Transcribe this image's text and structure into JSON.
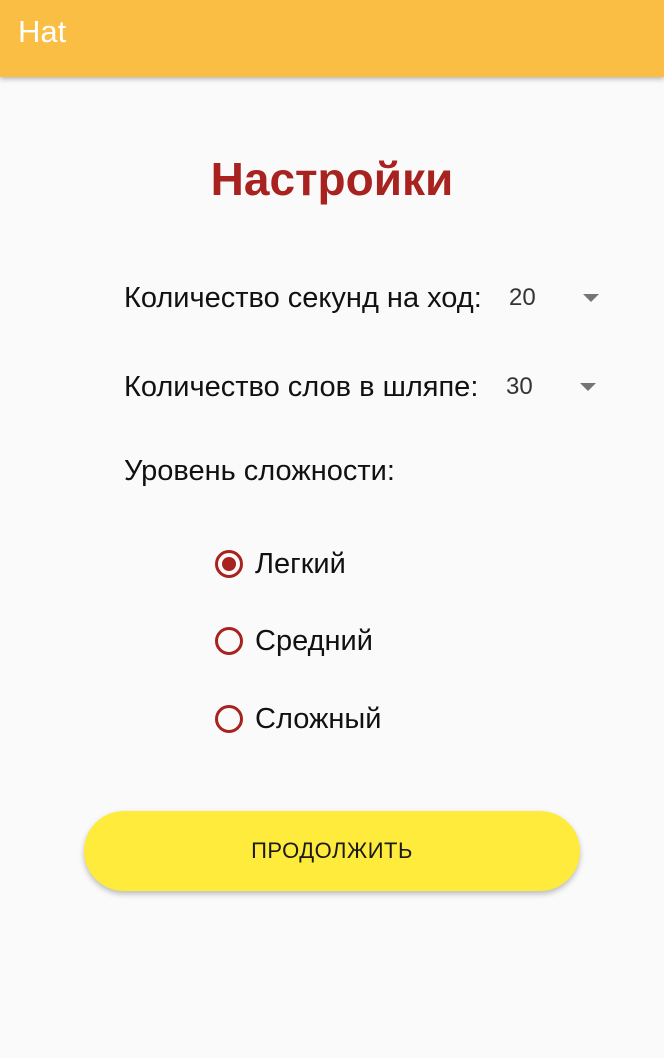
{
  "app_bar": {
    "title": "Hat",
    "color": "#fbbe44"
  },
  "page": {
    "title": "Настройки",
    "title_color": "#a8231f"
  },
  "settings": {
    "seconds_per_turn": {
      "label": "Количество секунд на ход:",
      "value": "20"
    },
    "words_in_hat": {
      "label": "Количество слов в шляпе:",
      "value": "30"
    }
  },
  "difficulty": {
    "label": "Уровень сложности:",
    "options": [
      {
        "label": "Легкий",
        "selected": true
      },
      {
        "label": "Средний",
        "selected": false
      },
      {
        "label": "Сложный",
        "selected": false
      }
    ],
    "accent_color": "#a8231f"
  },
  "continue_button": {
    "label": "ПРОДОЛЖИТЬ",
    "color": "#ffeb3b"
  }
}
